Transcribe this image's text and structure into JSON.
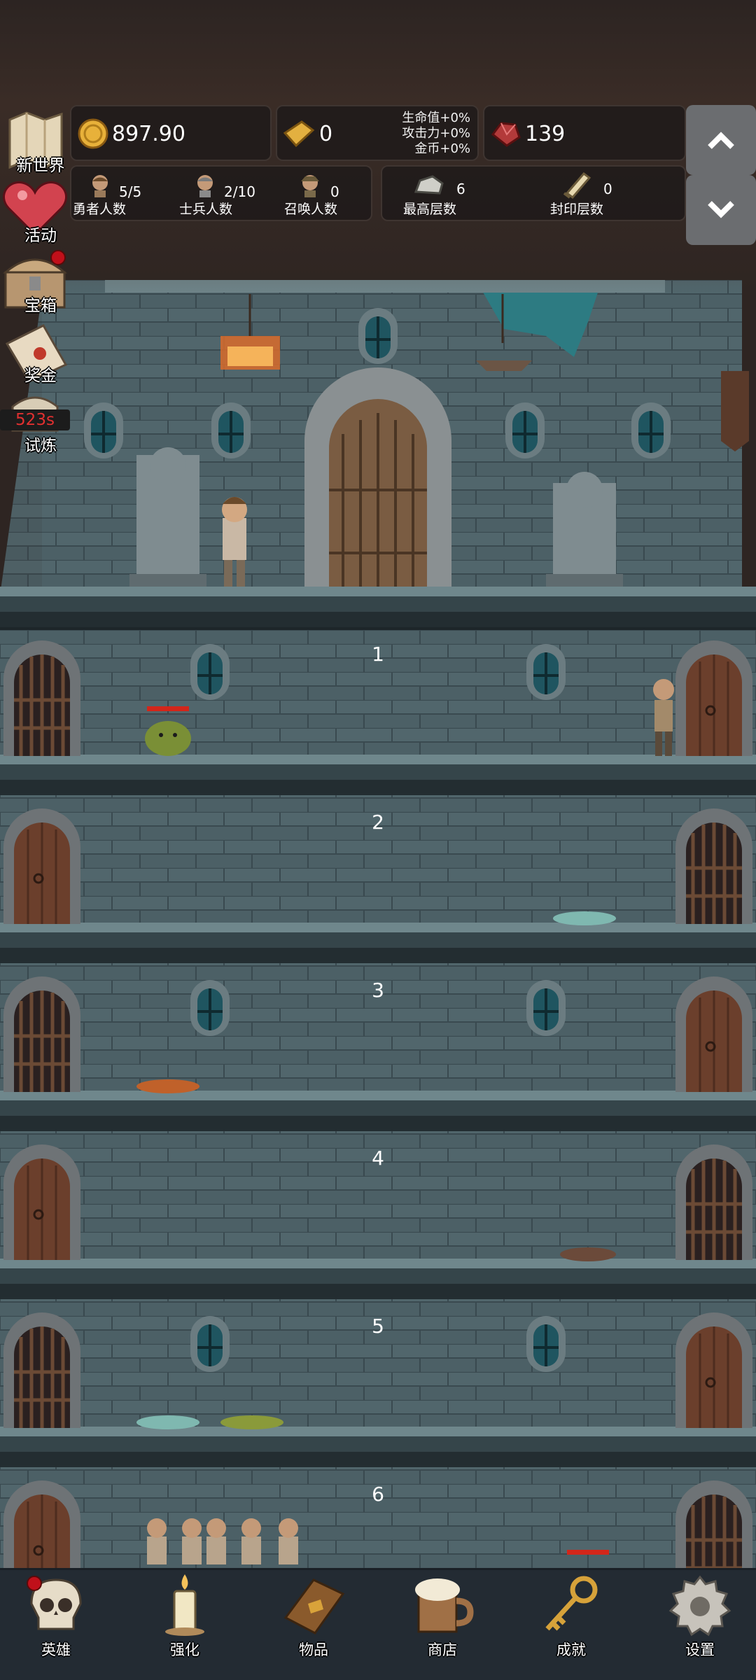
{
  "resources": {
    "gold": "897.90",
    "gold_bar": "0",
    "bonus_lines": [
      "生命值+0%",
      "攻击力+0%",
      "金币+0%"
    ],
    "gem": "139"
  },
  "counters": {
    "heroes": {
      "value": "5/5",
      "label": "勇者人数"
    },
    "soldiers": {
      "value": "2/10",
      "label": "士兵人数"
    },
    "summons": {
      "value": "0",
      "label": "召唤人数"
    },
    "highest_floor": {
      "value": "6",
      "label": "最高层数"
    },
    "sealed_floors": {
      "value": "0",
      "label": "封印层数"
    }
  },
  "side_menu": [
    {
      "label": "新世界",
      "icon": "map-icon"
    },
    {
      "label": "活动",
      "icon": "heart-icon"
    },
    {
      "label": "宝箱",
      "icon": "chest-icon",
      "dot": true
    },
    {
      "label": "奖金",
      "icon": "envelope-icon"
    },
    {
      "label": "试炼",
      "icon": "trial-icon",
      "timer": "523s"
    }
  ],
  "floors": [
    "1",
    "2",
    "3",
    "4",
    "5",
    "6"
  ],
  "bottom_nav": [
    {
      "label": "英雄",
      "icon": "skull-icon",
      "dot": true
    },
    {
      "label": "强化",
      "icon": "candle-icon"
    },
    {
      "label": "物品",
      "icon": "book-icon"
    },
    {
      "label": "商店",
      "icon": "beer-mug-icon"
    },
    {
      "label": "成就",
      "icon": "key-icon"
    },
    {
      "label": "设置",
      "icon": "gear-icon"
    }
  ],
  "colors": {
    "wall": "#4a5d63",
    "wall_dark": "#2e3b40",
    "panel_bg": "#1c1818",
    "nav_bg": "#232b33",
    "alert_red": "#c0101a"
  }
}
